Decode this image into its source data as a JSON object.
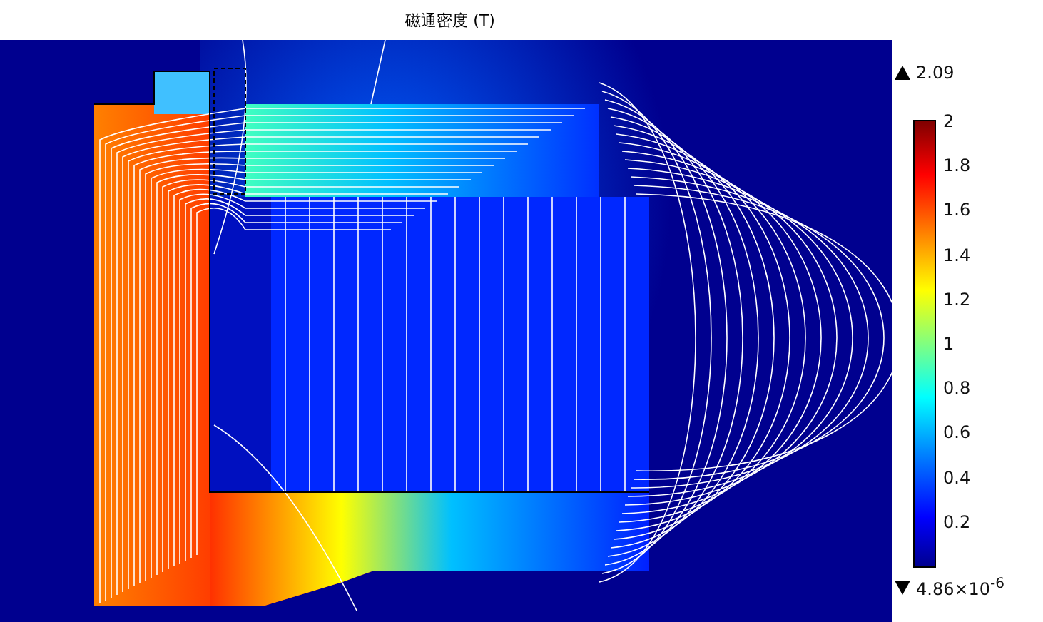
{
  "plot": {
    "title": "磁通密度 (T)"
  },
  "legend": {
    "max": "2.09",
    "min": "4.86×10$^{-6}$",
    "ticks": [
      "2",
      "1.8",
      "1.6",
      "1.4",
      "1.2",
      "1",
      "0.8",
      "0.6",
      "0.4",
      "0.2"
    ]
  }
}
